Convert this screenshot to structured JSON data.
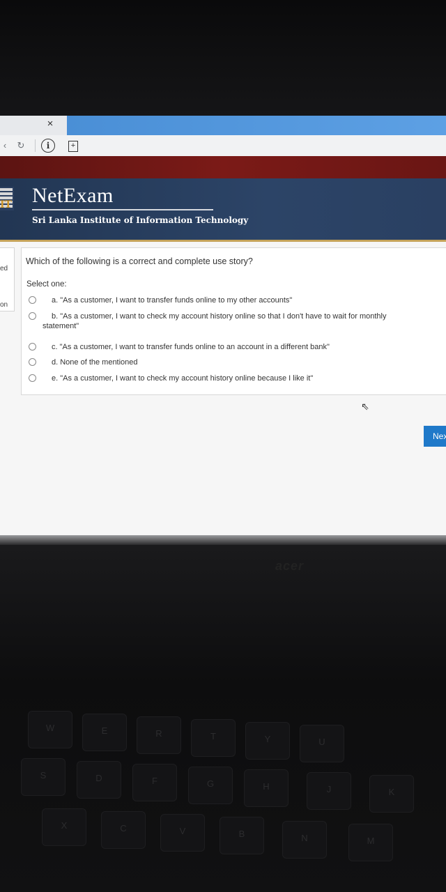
{
  "browser": {
    "tab_close": "×",
    "reload_symbol": "↻",
    "info_symbol": "i",
    "page_symbol": "+"
  },
  "header": {
    "logo_letters": "IT",
    "brand": "NetExam",
    "subtitle": "Sri Lanka Institute of Information Technology"
  },
  "sidebar": {
    "stub_1": "ed",
    "stub_2": "on"
  },
  "question": {
    "text": "Which of the following is a correct and complete use story?",
    "prompt": "Select one:",
    "options": [
      {
        "label": "a. \"As a customer, I want to transfer funds online to my other accounts\""
      },
      {
        "label": "b. \"As a customer, I want to check my account history online so that I don't have to wait for monthly",
        "label_cont": "statement\""
      },
      {
        "label": "c. \"As a customer, I want to transfer funds online to an account in a different bank\""
      },
      {
        "label": "d. None of the mentioned"
      },
      {
        "label": "e. \"As a customer, I want to check my account history online because I like it\""
      }
    ]
  },
  "nav": {
    "next_label": "Nex"
  },
  "laptop": {
    "brand": "acer",
    "keys": [
      "W",
      "E",
      "R",
      "T",
      "Y",
      "U",
      "S",
      "D",
      "F",
      "G",
      "H",
      "J",
      "K",
      "X",
      "C",
      "V",
      "B",
      "N",
      "M"
    ]
  }
}
